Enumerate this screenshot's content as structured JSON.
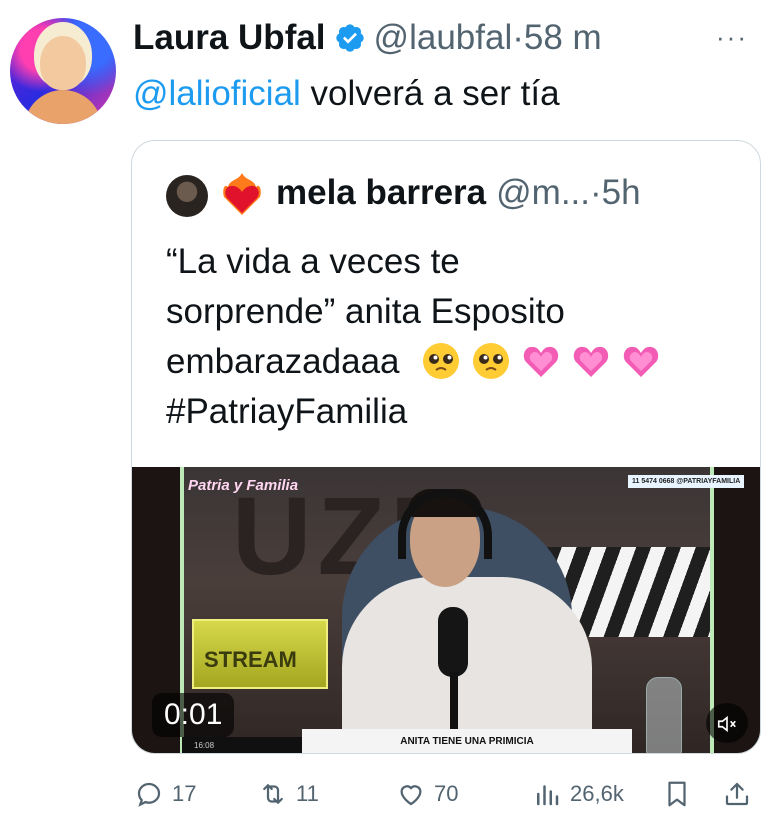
{
  "tweet": {
    "author_name": "Laura Ubfal",
    "handle_time": "@laubfal·58 m",
    "more": "···",
    "mention": "@lalioficial",
    "text_rest": " volverá a ser tía"
  },
  "quote": {
    "author_name": "mela barrera",
    "handle_time": "@m...·5h",
    "line1": "“La vida a veces te",
    "line2": "sorprende” anita Esposito",
    "line3": "embarazadaaa",
    "hashtag": "#PatriayFamilia",
    "emojis": [
      "pleading-face-icon",
      "pleading-face-icon",
      "growing-heart-icon",
      "growing-heart-icon",
      "growing-heart-icon"
    ]
  },
  "video": {
    "timestamp": "0:01",
    "show_logo": "Patria y Familia",
    "phone": "11 5474 0668 @PATRIAYFAMILIA",
    "stream_sign": "STREAM",
    "lower_third": "ANITA TIENE UNA PRIMICIA",
    "ticker_time": "16:08"
  },
  "actions": {
    "replies": "17",
    "retweets": "11",
    "likes": "70",
    "views": "26,6k"
  },
  "colors": {
    "link": "#1d9bf0",
    "secondary": "#536471",
    "border": "#cfd9de"
  }
}
